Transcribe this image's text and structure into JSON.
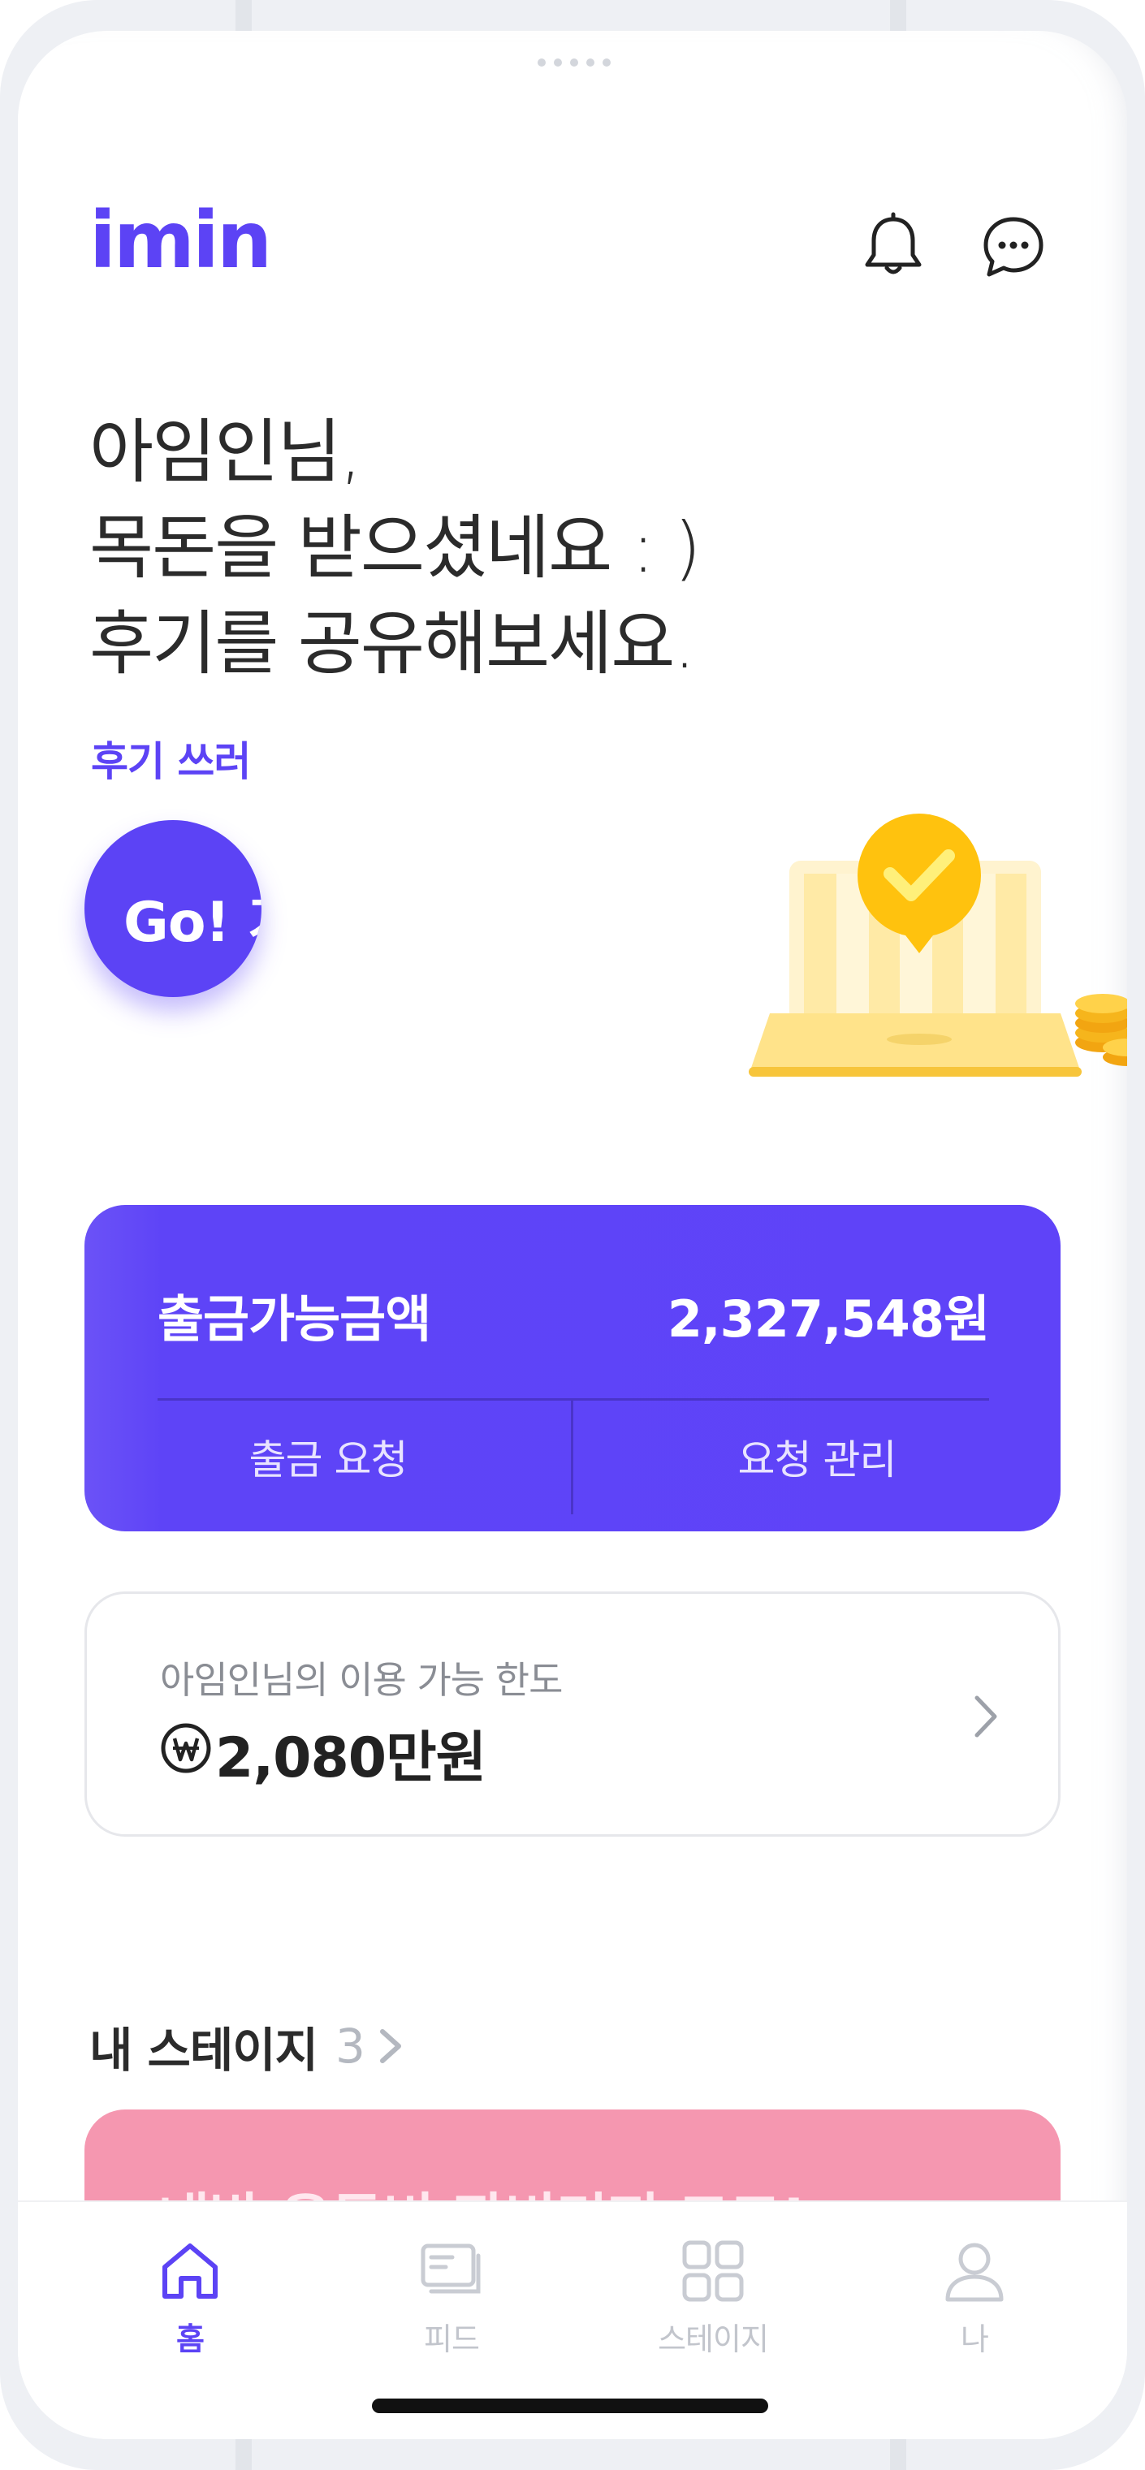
{
  "app": {
    "logo_text": "imin",
    "accent_color": "#5c43f5"
  },
  "header": {
    "notification_icon": "bell-icon",
    "chat_icon": "chat-bubble-icon"
  },
  "hero": {
    "greeting_lines": [
      "아임인님,",
      "목돈을 받으셨네요 : )",
      "후기를 공유해보세요."
    ],
    "review_link": "후기 쓰러",
    "go_button_label": "Go! 가기"
  },
  "balance": {
    "label": "출금가능금액",
    "amount": "2,327,548원",
    "withdraw_action": "출금 요청",
    "manage_action": "요청 관리",
    "card_color": "#5f43f8"
  },
  "limit": {
    "label": "아임인님의 이용 가능 한도",
    "value": "2,080만원",
    "currency_icon": "won-icon"
  },
  "stages": {
    "title": "내 스테이지",
    "count": "3",
    "first_card_title": "내방 은돈비 잔비미저 고고!",
    "first_card_color": "#f597b0"
  },
  "tab_bar": {
    "tabs": [
      {
        "label": "홈",
        "icon": "home-icon",
        "active": true
      },
      {
        "label": "피드",
        "icon": "feed-icon",
        "active": false
      },
      {
        "label": "스테이지",
        "icon": "grid-icon",
        "active": false
      },
      {
        "label": "나",
        "icon": "person-icon",
        "active": false
      }
    ]
  }
}
